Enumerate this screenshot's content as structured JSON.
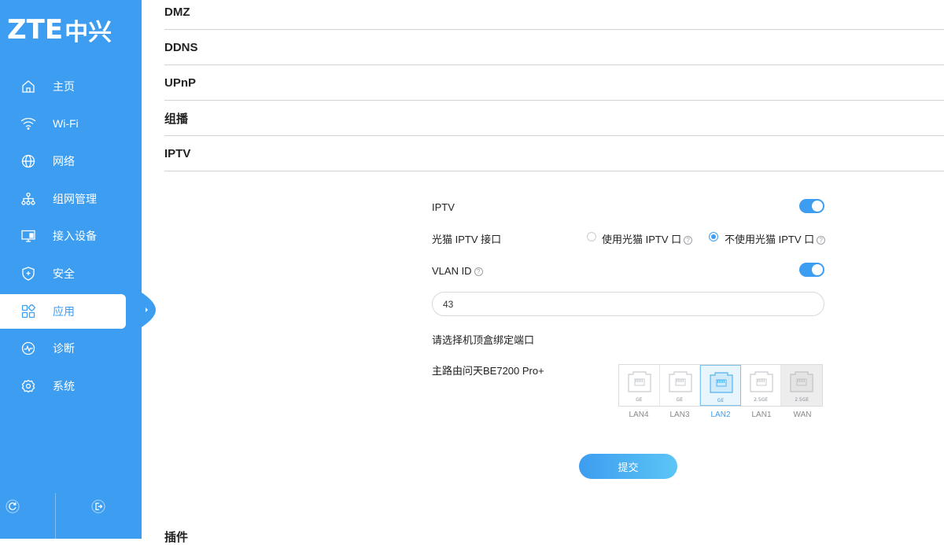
{
  "brand": {
    "logo_text": "ZTE",
    "logo_cn": "中兴"
  },
  "sidebar": {
    "items": [
      {
        "label": "主页",
        "icon": "home-icon"
      },
      {
        "label": "Wi-Fi",
        "icon": "wifi-icon"
      },
      {
        "label": "网络",
        "icon": "globe-icon"
      },
      {
        "label": "组网管理",
        "icon": "network-topology-icon"
      },
      {
        "label": "接入设备",
        "icon": "monitor-icon"
      },
      {
        "label": "安全",
        "icon": "shield-icon"
      },
      {
        "label": "应用",
        "icon": "apps-grid-icon",
        "active": true
      },
      {
        "label": "诊断",
        "icon": "diagnose-icon"
      },
      {
        "label": "系统",
        "icon": "gear-icon"
      }
    ],
    "bottom": [
      "refresh-icon",
      "logout-icon"
    ]
  },
  "sections": [
    "DMZ",
    "DDNS",
    "UPnP",
    "组播",
    "IPTV"
  ],
  "iptv": {
    "iptv_label": "IPTV",
    "iptv_enabled": true,
    "port_label": "光猫 IPTV 接口",
    "option_use": "使用光猫 IPTV 口",
    "option_not_use": "不使用光猫 IPTV 口",
    "selected_option": "不使用光猫 IPTV 口",
    "vlan_label": "VLAN ID",
    "vlan_enabled": true,
    "vlan_value": "43",
    "bind_label": "请选择机顶盒绑定端口",
    "router_label": "主路由问天BE7200 Pro+",
    "ports": [
      {
        "name": "LAN4",
        "type": "GE"
      },
      {
        "name": "LAN3",
        "type": "GE"
      },
      {
        "name": "LAN2",
        "type": "GE",
        "selected": true
      },
      {
        "name": "LAN1",
        "type": "2.5GE"
      },
      {
        "name": "WAN",
        "type": "2.5GE",
        "disabled": true
      }
    ],
    "submit_label": "提交"
  },
  "bottom_section": "插件",
  "colors": {
    "accent": "#3d9df0",
    "sidebar_bg": "#3d9df0"
  }
}
